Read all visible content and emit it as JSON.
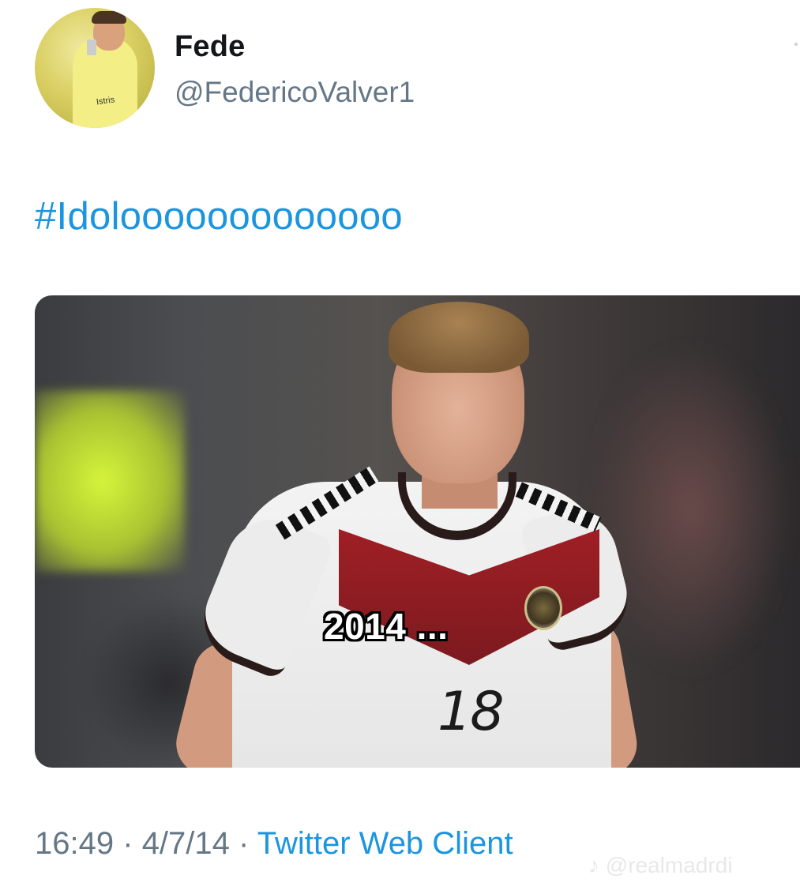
{
  "tweet": {
    "author_name": "Fede",
    "author_handle": "@FedericoValver1",
    "avatar_shirt_text": "Istris",
    "text": "#Idolooooooooooooo",
    "media_caption": "2014 ...",
    "media_jersey_number": "18",
    "time": "16:49",
    "date": "4/7/14",
    "separator": "·",
    "client": "Twitter Web Client"
  },
  "watermark": "♪ @realmadrdi",
  "colors": {
    "link": "#1b95e0",
    "secondary_text": "#657786",
    "primary_text": "#14171a"
  }
}
